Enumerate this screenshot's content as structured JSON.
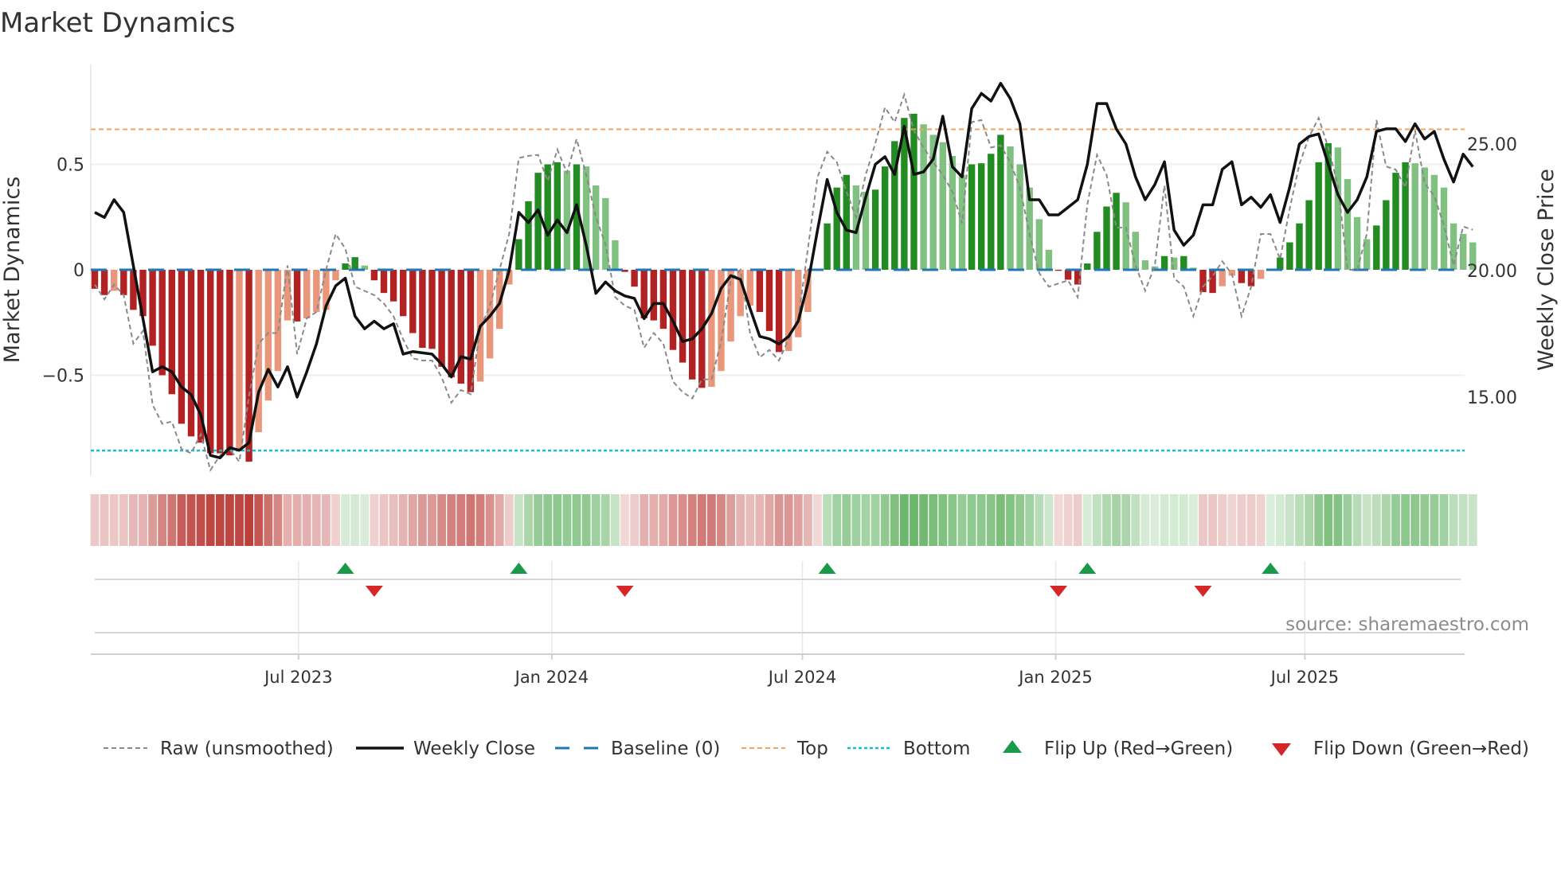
{
  "title": "Market Dynamics",
  "source": "source: sharemaestro.com",
  "colors": {
    "bar_up_strong": "#228b22",
    "bar_up_weak": "#80c080",
    "bar_down_strong": "#b22222",
    "bar_down_weak": "#e9967a",
    "close": "#111111",
    "raw": "#8a8a8a",
    "baseline": "#1f77b4",
    "top": "#f4a460",
    "bottom": "#17becf",
    "flip_up": "#1a9a48",
    "flip_down": "#d62728"
  },
  "chart_data": {
    "type": "bar",
    "title": "Market Dynamics",
    "ylabel": "Market Dynamics",
    "y2label": "Weekly Close Price",
    "ylim": [
      -0.98,
      0.98
    ],
    "y2lim": [
      12.5,
      28
    ],
    "start_week": "2023-02-03",
    "interval_days": 7,
    "left_ticks": [
      {
        "value": 0.5,
        "label": "0.5"
      },
      {
        "value": 0,
        "label": "0"
      },
      {
        "value": -0.5,
        "label": "−0.5"
      }
    ],
    "right_ticks": [
      {
        "value": 25,
        "label": "25.00"
      },
      {
        "value": 20,
        "label": "20.00"
      },
      {
        "value": 15,
        "label": "15.00"
      }
    ],
    "x_ticks": [
      {
        "date": "2023-07-01",
        "label": "Jul 2023"
      },
      {
        "date": "2024-01-01",
        "label": "Jan 2024"
      },
      {
        "date": "2024-07-01",
        "label": "Jul 2024"
      },
      {
        "date": "2025-01-01",
        "label": "Jan 2025"
      },
      {
        "date": "2025-07-01",
        "label": "Jul 2025"
      }
    ],
    "top_level": 0.666,
    "bottom_level": -0.857,
    "baseline": 0,
    "dynamics": [
      -0.09,
      -0.12,
      -0.1,
      -0.12,
      -0.19,
      -0.22,
      -0.36,
      -0.5,
      -0.59,
      -0.73,
      -0.79,
      -0.82,
      -0.87,
      -0.87,
      -0.88,
      -0.86,
      -0.91,
      -0.77,
      -0.62,
      -0.48,
      -0.24,
      -0.245,
      -0.23,
      -0.2,
      -0.19,
      -0.05,
      0.03,
      0.06,
      0.02,
      -0.05,
      -0.11,
      -0.15,
      -0.22,
      -0.3,
      -0.37,
      -0.375,
      -0.46,
      -0.51,
      -0.54,
      -0.58,
      -0.53,
      -0.42,
      -0.28,
      -0.07,
      0.145,
      0.325,
      0.46,
      0.5,
      0.51,
      0.47,
      0.5,
      0.49,
      0.4,
      0.34,
      0.14,
      -0.01,
      -0.08,
      -0.23,
      -0.24,
      -0.28,
      -0.38,
      -0.44,
      -0.52,
      -0.56,
      -0.555,
      -0.48,
      -0.34,
      -0.22,
      -0.17,
      -0.2,
      -0.29,
      -0.39,
      -0.385,
      -0.32,
      -0.2,
      -0.005,
      0.22,
      0.39,
      0.45,
      0.4,
      0.37,
      0.38,
      0.49,
      0.61,
      0.72,
      0.74,
      0.69,
      0.64,
      0.605,
      0.54,
      0.45,
      0.5,
      0.505,
      0.55,
      0.64,
      0.585,
      0.5,
      0.39,
      0.24,
      0.095,
      -0.005,
      -0.047,
      -0.07,
      0.03,
      0.18,
      0.3,
      0.365,
      0.32,
      0.18,
      0.045,
      0.016,
      0.065,
      0.058,
      0.065,
      0.01,
      -0.106,
      -0.11,
      -0.078,
      -0.028,
      -0.063,
      -0.078,
      -0.043,
      0.005,
      0.058,
      0.13,
      0.22,
      0.33,
      0.51,
      0.6,
      0.58,
      0.43,
      0.25,
      0.145,
      0.21,
      0.33,
      0.46,
      0.51,
      0.505,
      0.485,
      0.45,
      0.39,
      0.22,
      0.17,
      0.13
    ],
    "raw": [
      -0.07,
      -0.14,
      -0.07,
      -0.12,
      -0.35,
      -0.29,
      -0.64,
      -0.73,
      -0.72,
      -0.85,
      -0.87,
      -0.78,
      -0.95,
      -0.88,
      -0.85,
      -0.91,
      -0.6,
      -0.35,
      -0.3,
      -0.3,
      0.02,
      -0.4,
      -0.23,
      -0.2,
      0.0,
      0.17,
      0.1,
      -0.08,
      -0.1,
      -0.12,
      -0.16,
      -0.22,
      -0.33,
      -0.42,
      -0.43,
      -0.43,
      -0.51,
      -0.63,
      -0.57,
      -0.59,
      -0.28,
      -0.17,
      0.0,
      0.17,
      0.53,
      0.54,
      0.545,
      0.42,
      0.57,
      0.46,
      0.62,
      0.45,
      0.25,
      0.12,
      -0.13,
      -0.17,
      -0.19,
      -0.37,
      -0.3,
      -0.35,
      -0.53,
      -0.58,
      -0.61,
      -0.52,
      -0.52,
      -0.34,
      -0.05,
      0.0,
      -0.3,
      -0.415,
      -0.38,
      -0.43,
      -0.33,
      -0.23,
      0.1,
      0.44,
      0.56,
      0.51,
      0.37,
      0.25,
      0.45,
      0.6,
      0.77,
      0.7,
      0.83,
      0.66,
      0.58,
      0.51,
      0.45,
      0.37,
      0.22,
      0.7,
      0.71,
      0.58,
      0.59,
      0.51,
      0.39,
      0.17,
      -0.015,
      -0.08,
      -0.065,
      -0.05,
      -0.13,
      0.31,
      0.545,
      0.45,
      0.2,
      0.2,
      0.02,
      -0.1,
      0.02,
      0.4,
      -0.04,
      -0.08,
      -0.22,
      -0.08,
      -0.03,
      0.04,
      -0.02,
      -0.22,
      -0.08,
      0.17,
      0.17,
      0.05,
      0.29,
      0.5,
      0.63,
      0.72,
      0.58,
      0.4,
      0.0,
      0.0,
      0.17,
      0.71,
      0.49,
      0.475,
      0.39,
      0.66,
      0.41,
      0.35,
      0.21,
      0.02,
      0.205,
      0.19
    ],
    "close": [
      22.3,
      22.1,
      22.8,
      22.3,
      20.2,
      18.1,
      16.0,
      16.2,
      16.0,
      15.4,
      15.1,
      14.3,
      12.7,
      12.6,
      13.0,
      12.9,
      13.2,
      15.2,
      16.1,
      15.4,
      16.2,
      15.0,
      16.0,
      17.1,
      18.6,
      19.4,
      19.7,
      18.2,
      17.7,
      18.0,
      17.7,
      17.9,
      16.7,
      16.8,
      16.75,
      16.7,
      16.3,
      15.8,
      16.6,
      16.5,
      17.8,
      18.2,
      18.7,
      20.0,
      22.3,
      21.9,
      22.4,
      21.4,
      22.0,
      21.5,
      22.6,
      21.0,
      19.1,
      19.55,
      19.2,
      19.0,
      18.9,
      18.1,
      18.7,
      18.7,
      18.0,
      17.2,
      17.3,
      17.7,
      18.3,
      19.3,
      19.8,
      19.65,
      18.5,
      17.4,
      17.3,
      17.1,
      17.4,
      18.0,
      19.5,
      21.6,
      23.6,
      22.3,
      21.6,
      21.5,
      22.9,
      24.2,
      24.5,
      23.8,
      25.7,
      23.8,
      23.9,
      24.4,
      26.1,
      24.1,
      23.7,
      26.4,
      27.0,
      26.7,
      27.4,
      26.8,
      25.8,
      22.8,
      22.8,
      22.2,
      22.2,
      22.5,
      22.8,
      24.2,
      26.6,
      26.6,
      25.6,
      25.0,
      23.7,
      22.8,
      23.4,
      24.3,
      21.6,
      21.0,
      21.4,
      22.6,
      22.6,
      24.0,
      24.3,
      22.6,
      22.9,
      22.5,
      23.0,
      21.9,
      23.3,
      25.0,
      25.3,
      25.4,
      24.2,
      23.0,
      22.3,
      22.8,
      23.7,
      25.5,
      25.6,
      25.6,
      25.1,
      25.8,
      25.2,
      25.5,
      24.4,
      23.5,
      24.6,
      24.1
    ],
    "legend": {
      "placement": "bottom",
      "items": [
        {
          "key": "raw",
          "label": "Raw (unsmoothed)"
        },
        {
          "key": "close",
          "label": "Weekly Close"
        },
        {
          "key": "baseline",
          "label": "Baseline (0)"
        },
        {
          "key": "top",
          "label": "Top"
        },
        {
          "key": "bottom",
          "label": "Bottom"
        },
        {
          "key": "flip_up",
          "label": "Flip Up (Red→Green)"
        },
        {
          "key": "flip_down",
          "label": "Flip Down (Green→Red)"
        }
      ]
    }
  }
}
